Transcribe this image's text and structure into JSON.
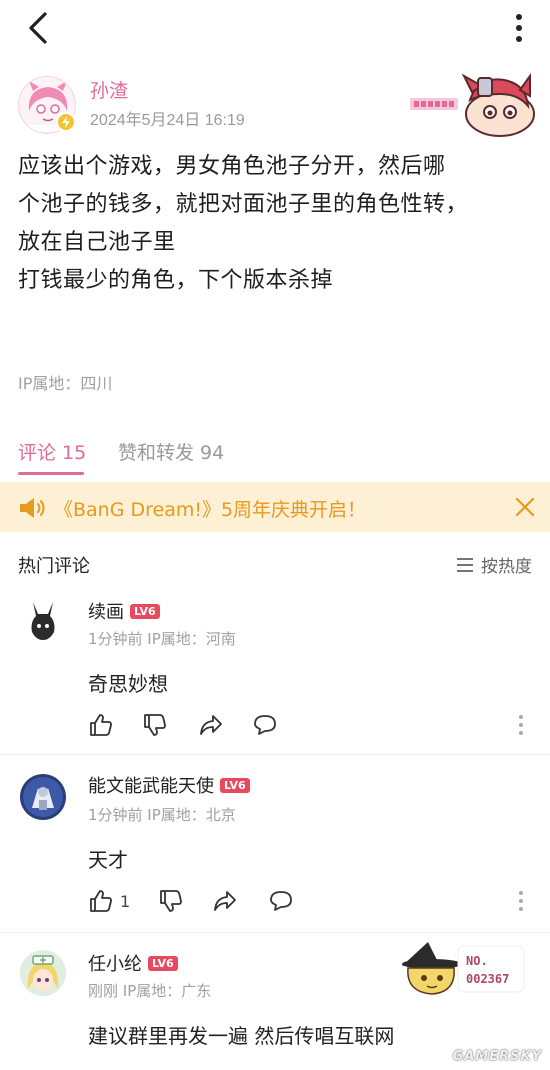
{
  "post": {
    "author": "孙渣",
    "time": "2024年5月24日 16:19",
    "lines": [
      "应该出个游戏，男女角色池子分开，然后哪",
      "个池子的钱多，就把对面池子里的角色性转，",
      "放在自己池子里",
      "打钱最少的角色，下个版本杀掉"
    ],
    "ip": "IP属地：四川"
  },
  "tabs": {
    "comments": "评论 15",
    "reposts": "赞和转发 94"
  },
  "banner": {
    "text": "《BanG Dream!》5周年庆典开启！"
  },
  "section": {
    "title": "热门评论",
    "sort": "按热度"
  },
  "comments": [
    {
      "name": "续画",
      "level": "LV6",
      "meta": "1分钟前  IP属地：河南",
      "text": "奇思妙想",
      "likes": ""
    },
    {
      "name": "能文能武能天使",
      "level": "LV6",
      "meta": "1分钟前  IP属地：北京",
      "text": "天才",
      "likes": "1"
    },
    {
      "name": "任小纶",
      "level": "LV6",
      "meta": "刚刚  IP属地：广东",
      "text": "建议群里再发一遍 然后传唱互联网",
      "sticker_no_label": "NO.",
      "sticker_no": "002367"
    }
  ],
  "watermark": "GAMERSKY",
  "colors": {
    "accent": "#e06b96",
    "banner_bg": "#fdf0d4",
    "banner_text": "#e59a20",
    "level_badge": "#e8495f"
  },
  "icons": {
    "back": "chevron-left-icon",
    "more": "more-vertical-icon",
    "speaker": "speaker-icon",
    "close": "close-icon",
    "sort": "menu-lines-icon",
    "like": "thumbs-up-icon",
    "dislike": "thumbs-down-icon",
    "share": "share-icon",
    "comment": "comment-bubble-icon"
  }
}
